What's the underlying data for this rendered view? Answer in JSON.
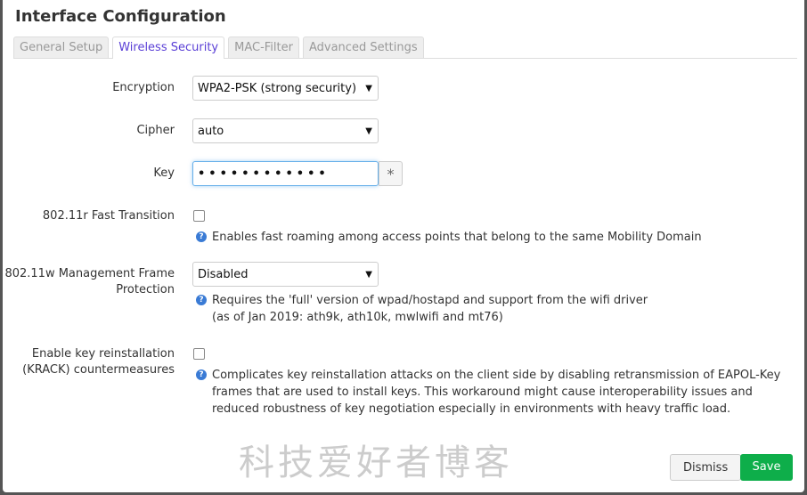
{
  "title": "Interface Configuration",
  "tabs": [
    "General Setup",
    "Wireless Security",
    "MAC-Filter",
    "Advanced Settings"
  ],
  "active_tab": "Wireless Security",
  "fields": {
    "encryption": {
      "label": "Encryption",
      "value": "WPA2-PSK (strong security)"
    },
    "cipher": {
      "label": "Cipher",
      "value": "auto"
    },
    "key": {
      "label": "Key",
      "value": "••••••••••••",
      "reveal": "*"
    },
    "ft": {
      "label": "802.11r Fast Transition",
      "checked": false,
      "help": "Enables fast roaming among access points that belong to the same Mobility Domain"
    },
    "mfp": {
      "label": "802.11w Management Frame Protection",
      "value": "Disabled",
      "help1": "Requires the 'full' version of wpad/hostapd and support from the wifi driver",
      "help2": "(as of Jan 2019: ath9k, ath10k, mwlwifi and mt76)"
    },
    "krack": {
      "label": "Enable key reinstallation (KRACK) countermeasures",
      "checked": false,
      "help": "Complicates key reinstallation attacks on the client side by disabling retransmission of EAPOL-Key frames that are used to install keys. This workaround might cause interoperability issues and reduced robustness of key negotiation especially in environments with heavy traffic load."
    }
  },
  "buttons": {
    "dismiss": "Dismiss",
    "save": "Save"
  },
  "watermark": "科技爱好者博客",
  "colors": {
    "accent": "#5a3fd6",
    "save": "#0eae4a"
  }
}
